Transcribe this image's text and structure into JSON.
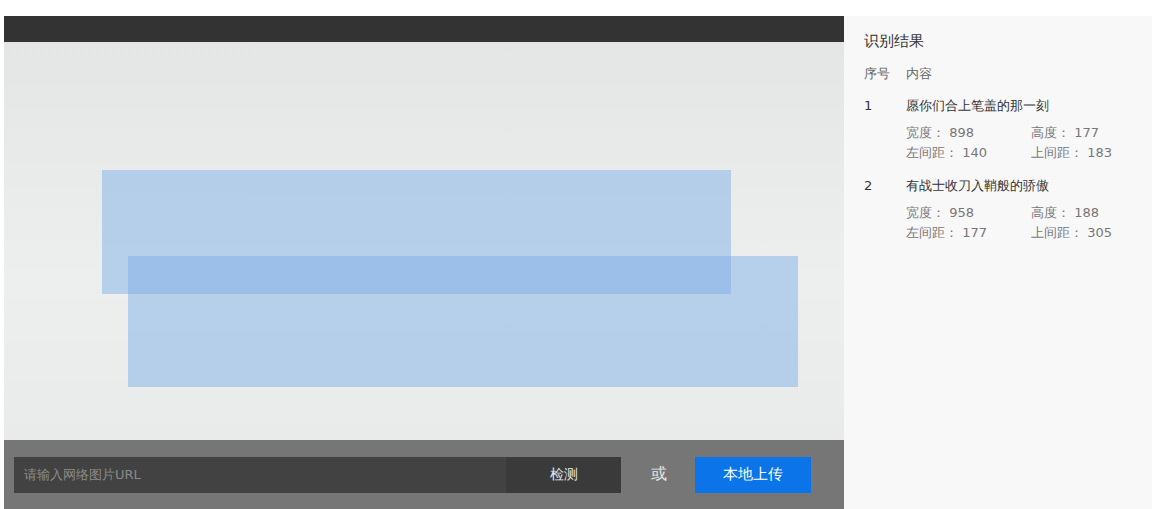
{
  "upload": {
    "url_placeholder": "请输入网络图片URL",
    "detect_button": "检测",
    "or_label": "或",
    "upload_button": "本地上传"
  },
  "results": {
    "title": "识别结果",
    "columns": [
      "序号",
      "内容"
    ],
    "field_labels": {
      "width": "宽度：",
      "height": "高度：",
      "left": "左间距：",
      "top": "上间距："
    },
    "items": [
      {
        "index": "1",
        "text": "愿你们合上笔盖的那一刻",
        "width": "898",
        "height": "177",
        "left": "140",
        "top": "183"
      },
      {
        "index": "2",
        "text": "有战士收刀入鞘般的骄傲",
        "width": "958",
        "height": "188",
        "left": "177",
        "top": "305"
      }
    ]
  }
}
